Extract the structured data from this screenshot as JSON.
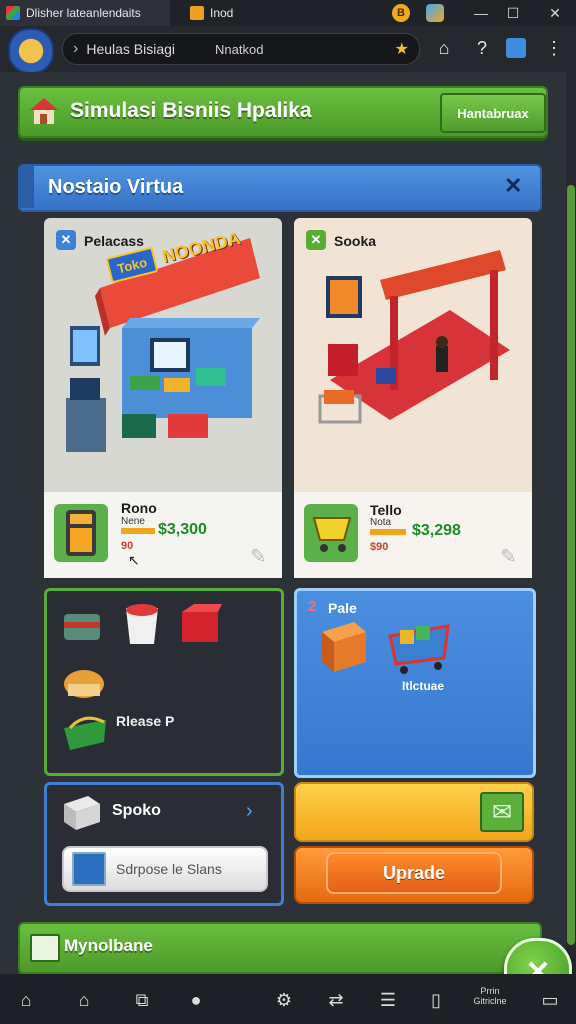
{
  "browser": {
    "tab1_title": "Dlisher lateanlendaits",
    "tab2_title": "Inod",
    "address_text": "Heulas Bisiagi",
    "address_secondary": "Nnatkod"
  },
  "header": {
    "title": "Simulasi Bisniis Hpalika",
    "action_label": "Hantabruax"
  },
  "panel": {
    "title": "Nostaio Virtua"
  },
  "cards": [
    {
      "title": "Pelacass",
      "sign_left": "Toko",
      "sign_right": "NOONDA",
      "name": "Rono",
      "sub": "Nene",
      "price": "$3,300",
      "value": "90"
    },
    {
      "title": "Sooka",
      "name": "Tello",
      "sub": "Nota",
      "price": "$3,298",
      "value": "$90"
    }
  ],
  "items_card": {
    "label": "Rlease P"
  },
  "rule_card": {
    "title": "Pale",
    "number": "2",
    "footer": "Itlctuae"
  },
  "spoko_card": {
    "title": "Spoko",
    "button": "Sdrpose le Slans"
  },
  "upgrade": {
    "label": "Uprade"
  },
  "footer_bar": {
    "label": "Mynolbane"
  },
  "bottom_nav": {
    "label": "Prrin Gitriclne"
  },
  "colors": {
    "green": "#5aad34",
    "blue": "#3f82d6",
    "orange": "#f07a1e",
    "yellow": "#f6b52a",
    "price_green": "#1f8a2a"
  }
}
